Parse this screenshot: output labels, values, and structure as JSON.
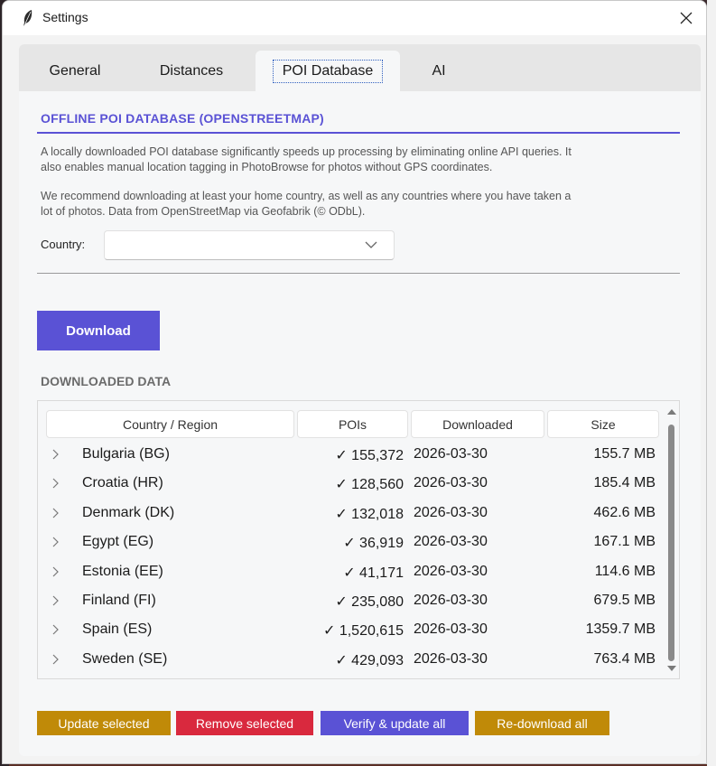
{
  "window": {
    "title": "Settings"
  },
  "tabs": [
    {
      "label": "General"
    },
    {
      "label": "Distances"
    },
    {
      "label": "POI Database"
    },
    {
      "label": "AI"
    }
  ],
  "section": {
    "title": "OFFLINE POI DATABASE (OPENSTREETMAP)",
    "desc1_line1": "A locally downloaded POI database significantly speeds up processing by eliminating online API queries. It",
    "desc1_line2": "also enables manual location tagging in PhotoBrowse for photos without GPS coordinates.",
    "desc2_line1": "We recommend downloading at least your home country, as well as any countries where you have taken a",
    "desc2_line2": "lot of photos. Data from OpenStreetMap via Geofabrik (© ODbL).",
    "country_label": "Country:",
    "country_value": "",
    "download_label": "Download"
  },
  "downloaded": {
    "title": "DOWNLOADED DATA",
    "columns": [
      "Country / Region",
      "POIs",
      "Downloaded",
      "Size"
    ],
    "rows": [
      {
        "name": "Bulgaria (BG)",
        "pois": "✓ 155,372",
        "date": "2026-03-30",
        "size": "155.7 MB"
      },
      {
        "name": "Croatia (HR)",
        "pois": "✓ 128,560",
        "date": "2026-03-30",
        "size": "185.4 MB"
      },
      {
        "name": "Denmark (DK)",
        "pois": "✓ 132,018",
        "date": "2026-03-30",
        "size": "462.6 MB"
      },
      {
        "name": "Egypt (EG)",
        "pois": "✓ 36,919",
        "date": "2026-03-30",
        "size": "167.1 MB"
      },
      {
        "name": "Estonia (EE)",
        "pois": "✓ 41,171",
        "date": "2026-03-30",
        "size": "114.6 MB"
      },
      {
        "name": "Finland (FI)",
        "pois": "✓ 235,080",
        "date": "2026-03-30",
        "size": "679.5 MB"
      },
      {
        "name": "Spain (ES)",
        "pois": "✓ 1,520,615",
        "date": "2026-03-30",
        "size": "1359.7 MB"
      },
      {
        "name": "Sweden (SE)",
        "pois": "✓ 429,093",
        "date": "2026-03-30",
        "size": "763.4 MB"
      }
    ]
  },
  "actions": {
    "update_selected": "Update selected",
    "remove_selected": "Remove selected",
    "verify_update_all": "Verify & update all",
    "redownload_all": "Re-download all"
  },
  "colors": {
    "accent": "#5a52d5",
    "update": "#c08a08",
    "remove": "#d9293e",
    "verify": "#5a52d5",
    "redownload": "#c08a08"
  }
}
